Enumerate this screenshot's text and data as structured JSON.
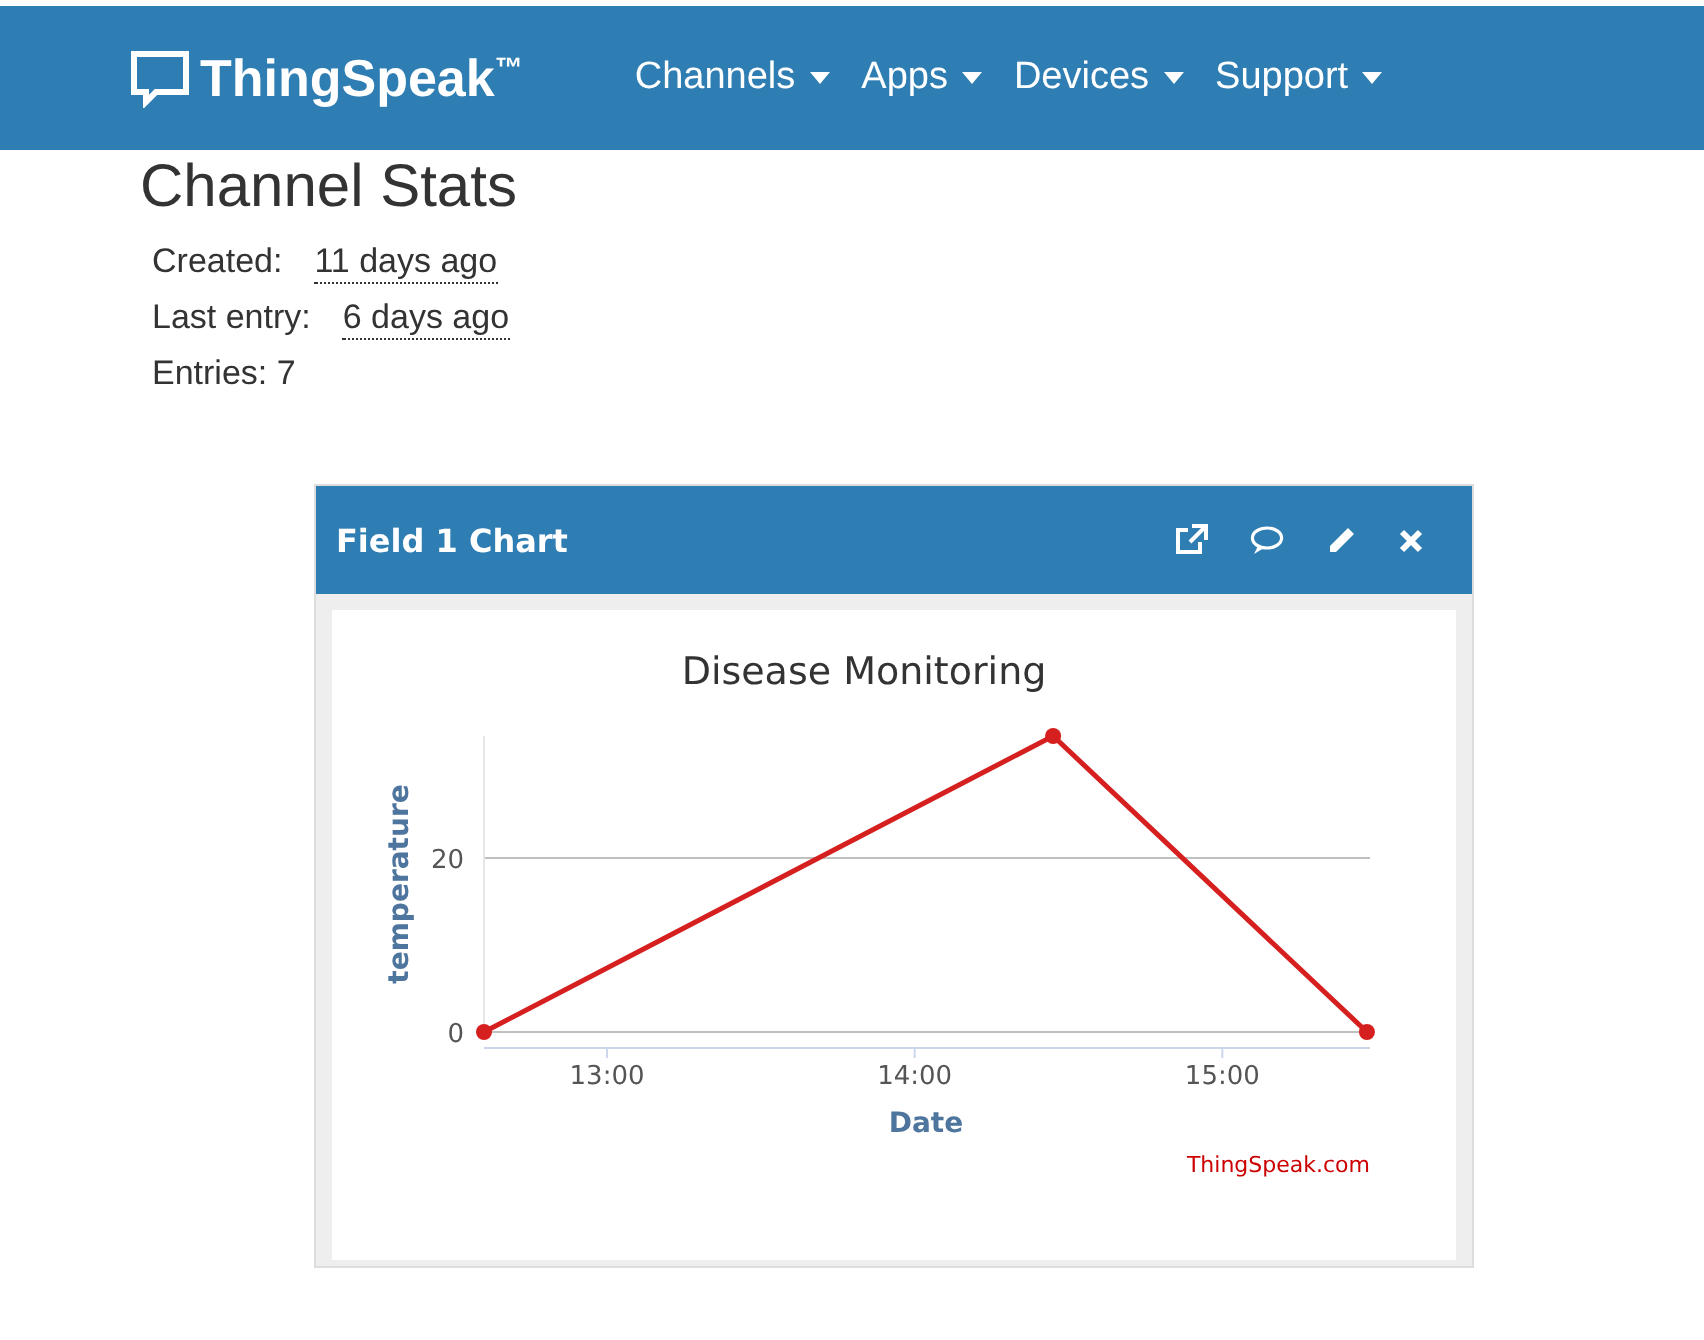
{
  "navbar": {
    "brand": "ThingSpeak",
    "trademark": "™",
    "menus": [
      {
        "label": "Channels"
      },
      {
        "label": "Apps"
      },
      {
        "label": "Devices"
      },
      {
        "label": "Support"
      }
    ]
  },
  "stats": {
    "title": "Channel Stats",
    "rows": [
      {
        "label": "Created:",
        "value": "11 days ago"
      },
      {
        "label": "Last entry:",
        "value": "6 days ago"
      },
      {
        "label": "Entries: 7"
      }
    ]
  },
  "panel": {
    "title": "Field 1 Chart",
    "credit": "ThingSpeak.com",
    "chart_data": {
      "type": "line",
      "title": "Disease Monitoring",
      "xlabel": "Date",
      "ylabel": "temperature",
      "x": [
        12.6,
        14.45,
        15.47
      ],
      "series": [
        {
          "color": "#d62020",
          "marker": true,
          "values": [
            0,
            34,
            0
          ]
        }
      ],
      "xlim": [
        12.6,
        15.48
      ],
      "ylim": [
        0,
        34
      ],
      "xticks": [
        {
          "value": 13,
          "label": "13:00"
        },
        {
          "value": 14,
          "label": "14:00"
        },
        {
          "value": 15,
          "label": "15:00"
        }
      ],
      "yticks": [
        0,
        20
      ]
    }
  }
}
